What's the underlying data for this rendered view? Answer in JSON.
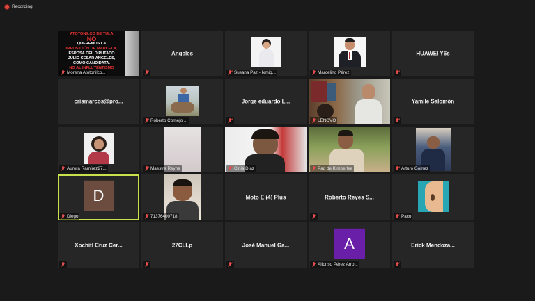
{
  "recording": {
    "label": "Recording"
  },
  "colors": {
    "active_speaker_border": "#c9e14a",
    "muted_mic": "#e04d4d"
  },
  "tiles": [
    {
      "label": "Morena Atotonilco...",
      "poster": {
        "line1": "ATOTONILCO DE TULA",
        "line2": "NO",
        "line3": "QUEREMOS LA",
        "line4": "IMPOSICIÓN DE MARCELA,",
        "line5": "ESPOSA DEL DIPUTADO",
        "line6": "JULIO CÉSAR ÁNGELES,",
        "line7": "COMO CANDIDATA.",
        "line8": "NO AL INFLUYENTISMO"
      }
    },
    {
      "name": "Angeles"
    },
    {
      "label": "Susana Paz - Ixmiq..."
    },
    {
      "label": "Marcelino Pérez"
    },
    {
      "name": "HUAWEI Y6s"
    },
    {
      "name": "crismarcos@pro..."
    },
    {
      "label": "Roberto Cornejo ..."
    },
    {
      "name": "Jorge eduardo L..."
    },
    {
      "label": "LENOVO"
    },
    {
      "name": "Yamile Salomón"
    },
    {
      "label": "Aurora Ramírez27..."
    },
    {
      "label": "Maestra Reyna"
    },
    {
      "label": "Cinia Díaz"
    },
    {
      "label": "Pad de Kimberlee"
    },
    {
      "label": "Arturo Gomez"
    },
    {
      "label": "Diego",
      "avatar": "D"
    },
    {
      "label": "71376400718"
    },
    {
      "name": "Moto E (4) Plus"
    },
    {
      "name": "Roberto Reyes S..."
    },
    {
      "label": "Paco"
    },
    {
      "name": "Xochitl Cruz Cer..."
    },
    {
      "name": "27CLLp"
    },
    {
      "name": "José Manuel Ga..."
    },
    {
      "label": "Alfonso Pérez Arro...",
      "avatar": "A"
    },
    {
      "name": "Erick Mendoza..."
    }
  ]
}
